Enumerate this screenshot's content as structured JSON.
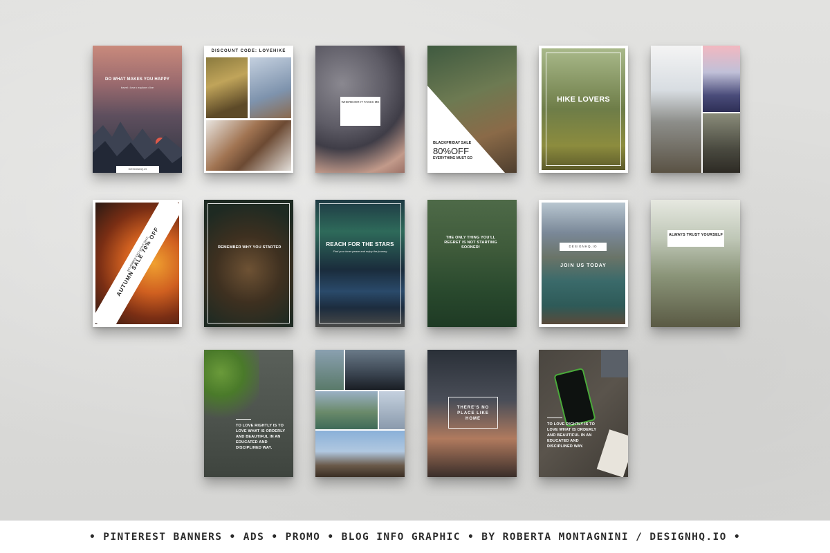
{
  "colors": {
    "background": "#dcdcda",
    "footer_bg": "#ffffff",
    "footer_text": "#2b2b2b"
  },
  "cards": {
    "c1": {
      "title": "DO WHAT MAKES YOU HAPPY",
      "subtitle": "travel • love • explore • live",
      "badge": "DESIGNHQ.IO"
    },
    "c2": {
      "title": "DISCOUNT CODE: LOVEHIKE"
    },
    "c3": {
      "title": "WHEREVER IT TAKES ME"
    },
    "c4": {
      "line1": "BLACKFRIDAY SALE",
      "line2": "80%OFF",
      "line3": "EVERYTHING MUST GO"
    },
    "c5": {
      "title": "HIKE LOVERS"
    },
    "c7": {
      "small": "NOVEMBER EXCLUSIVE SALE",
      "title": "AUTUMN SALE 70% OFF"
    },
    "c8": {
      "title": "REMEMBER WHY YOU STARTED"
    },
    "c9": {
      "title": "REACH FOR THE STARS",
      "subtitle": "Find your inner peace and enjoy the journey"
    },
    "c10": {
      "title": "THE ONLY THING YOU'LL REGRET IS NOT STARTING SOONER!"
    },
    "c11": {
      "brand": "DESIGNHQ.IO",
      "title": "JOIN US TODAY"
    },
    "c12": {
      "title": "ALWAYS TRUST YOURSELF"
    },
    "c13": {
      "quote": "TO LOVE RIGHTLY IS TO LOVE WHAT IS ORDERLY AND BEAUTIFUL IN AN EDUCATED AND DISCIPLINED WAY."
    },
    "c15": {
      "title": "THERE'S NO PLACE LIKE HOME"
    },
    "c16": {
      "quote": "TO LOVE RIGHTLY IS TO LOVE WHAT IS ORDERLY AND BEAUTIFUL IN AN EDUCATED AND DISCIPLINED WAY."
    }
  },
  "footer": {
    "text": "• PINTEREST BANNERS • ADS • PROMO • BLOG INFO GRAPHIC • BY ROBERTA MONTAGNINI / DESIGNHQ.IO •"
  }
}
